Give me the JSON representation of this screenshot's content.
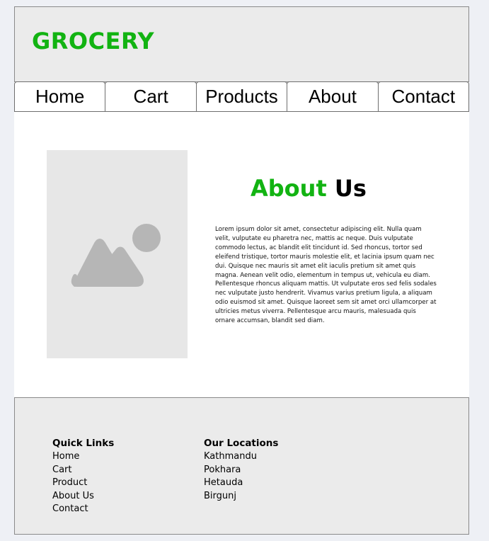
{
  "header": {
    "brand": "GROCERY",
    "brand_color": "#12b312"
  },
  "nav": {
    "items": [
      "Home",
      "Cart",
      "Products",
      "About",
      "Contact"
    ]
  },
  "about": {
    "image_icon": "image-placeholder-icon",
    "title_part1": "About",
    "title_part2": "Us",
    "text": "Lorem ipsum dolor sit amet, consectetur adipiscing elit. Nulla quam velit, vulputate eu pharetra nec, mattis ac neque. Duis vulputate commodo lectus, ac blandit elit tincidunt id. Sed rhoncus, tortor sed eleifend tristique, tortor mauris molestie elit, et lacinia ipsum quam nec dui. Quisque nec mauris sit amet elit iaculis pretium sit amet quis magna. Aenean velit odio, elementum in tempus ut, vehicula eu diam. Pellentesque rhoncus aliquam mattis. Ut vulputate eros sed felis sodales nec vulputate justo hendrerit. Vivamus varius pretium ligula, a aliquam odio euismod sit amet. Quisque laoreet sem sit amet orci ullamcorper at ultricies metus viverra. Pellentesque arcu mauris, malesuada quis ornare accumsan, blandit sed diam."
  },
  "footer": {
    "quick_links": {
      "heading": "Quick Links",
      "items": [
        "Home",
        "Cart",
        "Product",
        "About Us",
        "Contact"
      ]
    },
    "locations": {
      "heading": "Our Locations",
      "items": [
        "Kathmandu",
        "Pokhara",
        "Hetauda",
        "Birgunj"
      ]
    }
  }
}
